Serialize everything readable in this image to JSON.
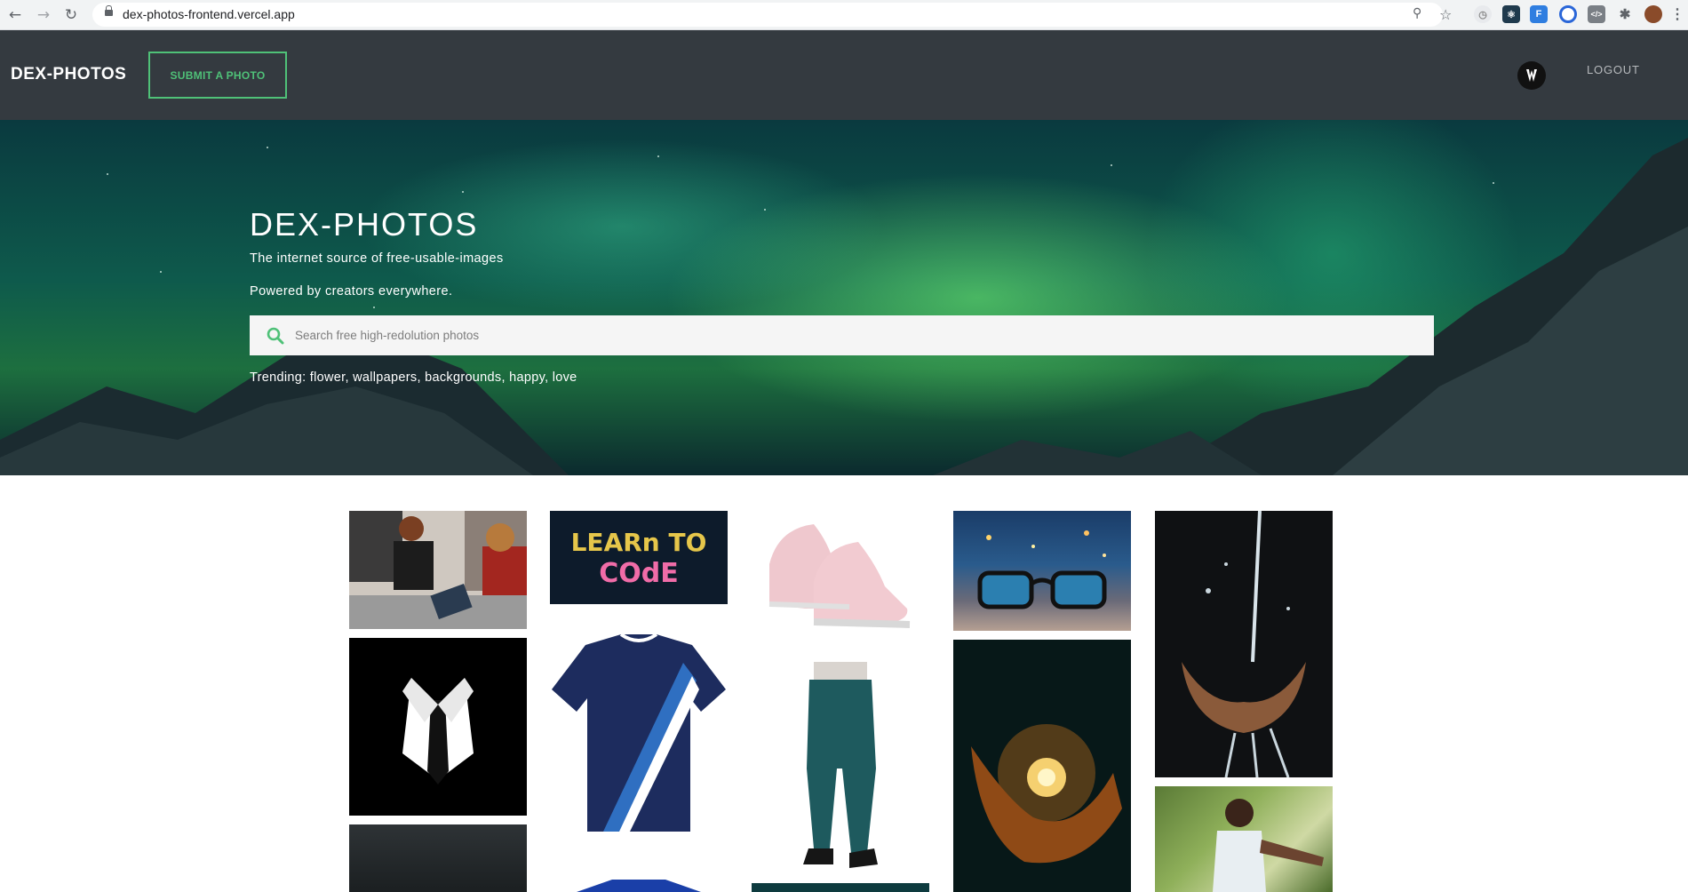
{
  "browser": {
    "url": "dex-photos-frontend.vercel.app"
  },
  "header": {
    "brand": "DEX-PHOTOS",
    "submit_label": "SUBMIT A PHOTO",
    "logout_label": "LOGOUT"
  },
  "hero": {
    "title": "DEX-PHOTOS",
    "subtitle": "The internet source of free-usable-images",
    "tagline": "Powered by creators everywhere.",
    "search_placeholder": "Search free high-redolution photos",
    "trending_label": "Trending:",
    "trending": [
      "flower",
      "wallpapers",
      "backgrounds",
      "happy",
      "love"
    ]
  },
  "gallery": {
    "photos": [
      {
        "subject": "woman-at-shop-counter"
      },
      {
        "subject": "learn-to-code",
        "text": "LEARn TO CODE"
      },
      {
        "subject": "pink-sneakers"
      },
      {
        "subject": "glasses-city-lights"
      },
      {
        "subject": "hands-with-water"
      },
      {
        "subject": "suit-and-tie"
      },
      {
        "subject": "navy-jersey"
      },
      {
        "subject": "teal-pants"
      },
      {
        "subject": "glowing-bulb-in-hand"
      },
      {
        "subject": "dark-water"
      },
      {
        "subject": "blue-jersey"
      },
      {
        "subject": "dark-photo"
      },
      {
        "subject": "woman-outdoors"
      }
    ]
  },
  "colors": {
    "header_bg": "#343a40",
    "accent": "#4fc178"
  }
}
